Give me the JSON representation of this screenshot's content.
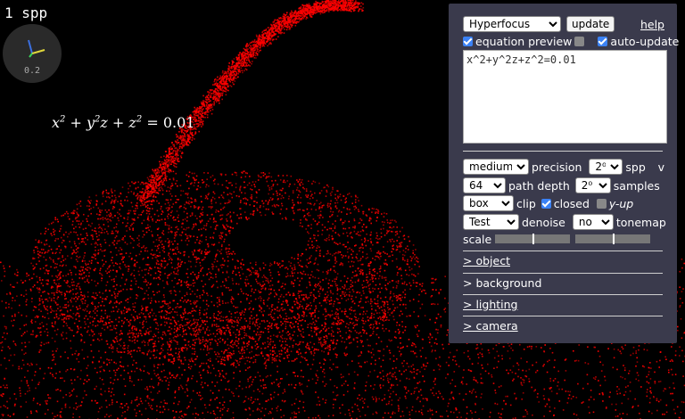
{
  "status": {
    "spp_text": "1 spp",
    "gizmo_value": "0.2"
  },
  "preview": {
    "lhs_x": "x",
    "lhs_y": "y",
    "lhs_z": "z",
    "exp": "2",
    "rhs": "0.01"
  },
  "panel": {
    "preset": {
      "selected": "Hyperfocus"
    },
    "update_label": "update",
    "help_label": "help",
    "equation_preview": {
      "label": "equation preview",
      "checked": true,
      "toggle_checked": false
    },
    "auto_update": {
      "label": "auto-update",
      "checked": true
    },
    "equation_text": "x^2+y^2z+z^2=0.01",
    "precision": {
      "selected": "medium",
      "label": "precision"
    },
    "spp": {
      "selected": "2⁰",
      "label": "spp"
    },
    "collapse_label": "v",
    "path_depth": {
      "selected": "64",
      "label": "path depth"
    },
    "samples": {
      "selected": "2⁰",
      "label": "samples"
    },
    "clip": {
      "selected": "box",
      "label": "clip"
    },
    "closed": {
      "label": "closed",
      "checked": true
    },
    "y_up": {
      "label": "y-up",
      "checked": false
    },
    "denoise": {
      "selected": "Test",
      "label": "denoise"
    },
    "tonemap": {
      "selected": "no",
      "label": "tonemap"
    },
    "scale_label": "scale",
    "scale_sliders": [
      {
        "value": 0.5
      },
      {
        "value": 0.5
      }
    ],
    "sections": [
      {
        "label": "> object"
      },
      {
        "label": "> background"
      },
      {
        "label": "> lighting"
      },
      {
        "label": "> camera"
      }
    ]
  },
  "colors": {
    "panel_bg": "#3a3a4c",
    "surface": "#ff0000",
    "background": "#000000"
  }
}
